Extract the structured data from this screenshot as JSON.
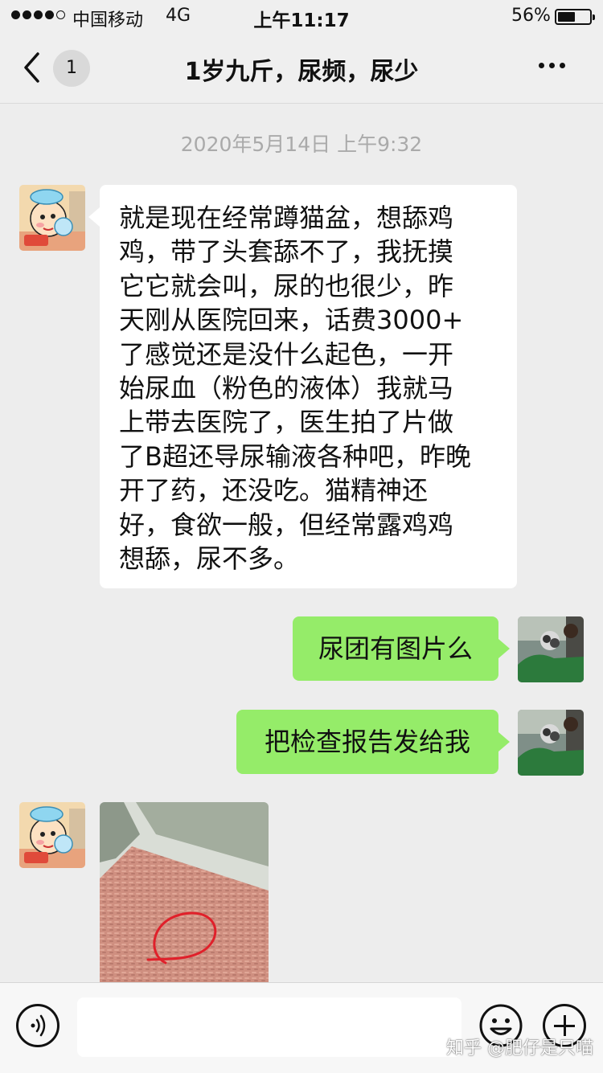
{
  "status_bar": {
    "carrier": "中国移动",
    "network": "4G",
    "time": "上午11:17",
    "battery_percent": "56%",
    "battery_level": 0.56,
    "signal_bars": 4
  },
  "nav": {
    "back_badge": "1",
    "title": "1岁九斤，尿频，尿少"
  },
  "chat": {
    "timestamp": "2020年5月14日 上午9:32",
    "incoming_text": "就是现在经常蹲猫盆，想舔鸡\n鸡，带了头套舔不了，我抚摸\n它它就会叫，尿的也很少，昨\n天刚从医院回来，话费3000+\n了感觉还是没什么起色，一开\n始尿血（粉色的液体）我就马\n上带去医院了，医生拍了片做\n了B超还导尿输液各种吧，昨晚\n开了药，还没吃。猫精神还\n好，食欲一般，但经常露鸡鸡\n想舔，尿不多。",
    "outgoing_1": "尿团有图片么",
    "outgoing_2": "把检查报告发给我"
  },
  "input": {
    "placeholder": ""
  },
  "watermark": "知乎 @肥仔是只喵",
  "colors": {
    "background": "#ededed",
    "bubble_out": "#95ec69",
    "bubble_in": "#ffffff",
    "timestamp": "#aaaaaa"
  },
  "icons": [
    "chevron-left-icon",
    "more-icon",
    "voice-icon",
    "emoji-icon",
    "plus-icon"
  ]
}
